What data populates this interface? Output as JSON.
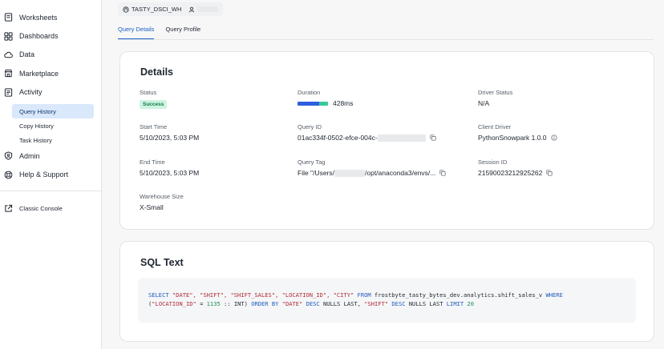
{
  "sidebar": {
    "items": [
      {
        "label": "Worksheets",
        "icon": "worksheets-icon"
      },
      {
        "label": "Dashboards",
        "icon": "dashboards-icon"
      },
      {
        "label": "Data",
        "icon": "cloud-icon"
      },
      {
        "label": "Marketplace",
        "icon": "marketplace-icon"
      },
      {
        "label": "Activity",
        "icon": "activity-icon"
      }
    ],
    "activity_subitems": [
      {
        "label": "Query History",
        "active": true
      },
      {
        "label": "Copy History",
        "active": false
      },
      {
        "label": "Task History",
        "active": false
      }
    ],
    "admin": "Admin",
    "help": "Help & Support",
    "classic_console": "Classic Console"
  },
  "header": {
    "warehouse": "TASTY_DSCI_WH"
  },
  "tabs": [
    {
      "label": "Query Details",
      "active": true
    },
    {
      "label": "Query Profile",
      "active": false
    }
  ],
  "details": {
    "title": "Details",
    "status": {
      "label": "Status",
      "value": "Success"
    },
    "duration": {
      "label": "Duration",
      "value": "428ms"
    },
    "driver_status": {
      "label": "Driver Status",
      "value": "N/A"
    },
    "start_time": {
      "label": "Start Time",
      "value": "5/10/2023, 5:03 PM"
    },
    "query_id": {
      "label": "Query ID",
      "value": "01ac334f-0502-efce-004c-"
    },
    "client_driver": {
      "label": "Client Driver",
      "value": "PythonSnowpark 1.0.0"
    },
    "end_time": {
      "label": "End Time",
      "value": "5/10/2023, 5:03 PM"
    },
    "query_tag": {
      "label": "Query Tag",
      "value_start": "File \"/Users/",
      "value_end": "/opt/anaconda3/envs/..."
    },
    "session_id": {
      "label": "Session ID",
      "value": "21590023212925262"
    },
    "warehouse_size": {
      "label": "Warehouse Size",
      "value": "X-Small"
    }
  },
  "sql": {
    "title": "SQL Text",
    "t01": "SELECT",
    "t02": "\"DATE\", \"SHIFT\", \"SHIFT_SALES\", \"LOCATION_ID\", \"CITY\"",
    "t03": "FROM",
    "t04": "frostbyte_tasty_bytes_dev.analytics.shift_sales_v",
    "t05": "WHERE",
    "t06": "(",
    "t07": "\"LOCATION_ID\"",
    "t08": "=",
    "t09": "1135",
    "t10": ":: INT)",
    "t11": "ORDER BY",
    "t12": "\"DATE\"",
    "t13": "DESC",
    "t14": "NULLS LAST,",
    "t15": "\"SHIFT\"",
    "t16": "DESC",
    "t17": "NULLS LAST",
    "t18": "LIMIT",
    "t19": "20"
  },
  "colors": {
    "accent": "#1c5fc3",
    "active_bg": "#d9e8fb",
    "success_bg": "#cdf3e1",
    "success_text": "#0f7a48",
    "duration_bar_primary": "#2e5fe0",
    "duration_bar_secondary": "#35c99b"
  }
}
